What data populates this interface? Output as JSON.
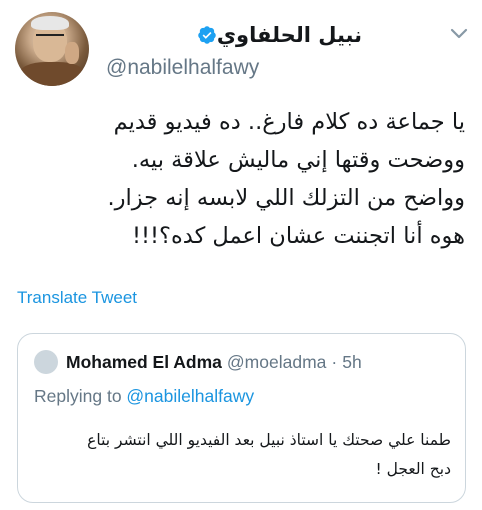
{
  "tweet": {
    "author": {
      "display_name": "نبيل الحلفاوي",
      "handle": "@nabilelhalfawy",
      "verified": true,
      "avatar_icon": "profile-photo"
    },
    "text_lines": [
      "يا جماعة ده كلام فارغ.. ده فيديو قديم",
      "ووضحت وقتها إني ماليش علاقة بيه.",
      "وواضح من التزلك اللي لابسه إنه جزار.",
      "هوه أنا اتجننت عشان اعمل كده؟!!!"
    ],
    "translate_label": "Translate Tweet",
    "menu_icon": "chevron-down-icon"
  },
  "quoted_tweet": {
    "author_name": "Mohamed El Adma",
    "handle": "@moeladma",
    "separator": "·",
    "time": "5h",
    "replying_prefix": "Replying to ",
    "replying_to": "@nabilelhalfawy",
    "text_lines": [
      "طمنا علي صحتك يا استاذ نبيل بعد الفيديو اللي انتشر بتاع",
      "دبح العجل !"
    ]
  },
  "colors": {
    "link": "#1b95e0",
    "secondary_text": "#657786",
    "border": "#ccd6dd",
    "primary_text": "#14171a"
  }
}
